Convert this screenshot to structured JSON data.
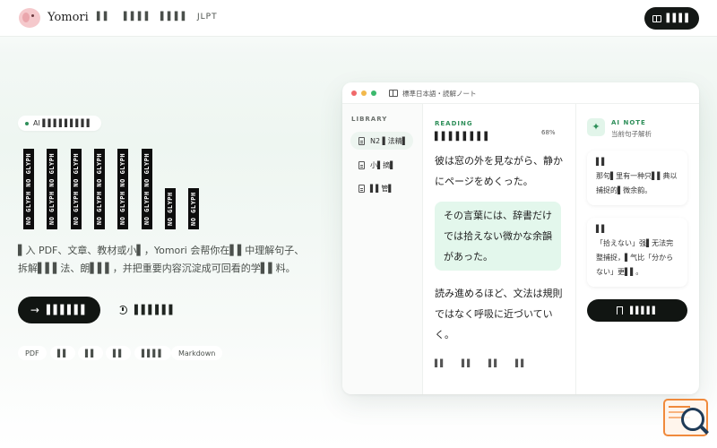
{
  "header": {
    "brand": "Yomori",
    "nav": [
      "▌▌",
      "▌▌▌▌",
      "▌▌▌▌",
      "JLPT"
    ],
    "cta_label": "▌▌▌▌"
  },
  "hero": {
    "tag": "AI ▌▌▌▌▌▌▌▌▌",
    "headline_bars": [
      "NO GLYPH NO GLYPH",
      "NO GLYPH NO GLYPH",
      "NO GLYPH NO GLYPH",
      "NO GLYPH NO GLYPH",
      "NO GLYPH NO GLYPH",
      "NO GLYPH NO GLYPH",
      "NO GLYPH",
      "NO GLYPH"
    ],
    "subtext_line1": "▌入 PDF、文章、教材或小▌，Yomori 会帮你在▌▌中理解句子、",
    "subtext_line2": "拆解▌▌▌法、朗▌▌▌，并把重要内容沉淀成可回看的学▌▌料。",
    "primary_cta": "▌▌▌▌▌▌",
    "secondary_cta": "▌▌▌▌▌▌",
    "chips": [
      "PDF",
      "▌▌",
      "▌▌",
      "▌▌",
      "▌▌▌▌",
      "Markdown"
    ]
  },
  "window": {
    "title": "標準日本語・読解ノート",
    "sidebar": {
      "title": "LIBRARY",
      "items": [
        {
          "label": "N2 ▌法精▌"
        },
        {
          "label": "小▌摘▌"
        },
        {
          "label": "▌▌管▌"
        }
      ]
    },
    "reader": {
      "label": "READING",
      "doc_title": "▌▌▌▌▌▌▌▌",
      "progress": "68%",
      "para1": "彼は窓の外を見ながら、静かにページをめくった。",
      "para2": "その言葉には、辞書だけでは拾えない微かな余韻があった。",
      "para3": "読み進めるほど、文法は規則ではなく呼吸に近づいていく。",
      "actions": [
        "▌▌",
        "▌▌",
        "▌▌",
        "▌▌"
      ]
    },
    "ai": {
      "label": "AI NOTE",
      "sub": "当前句子解析",
      "card1_title": "▌▌",
      "card1_body": "那句▌里有一种只▌▌典以捕捉的▌微余韵。",
      "card2_title": "▌▌",
      "card2_body": "「拾えない」强▌无法完整捕捉，▌气比「分からない」更▌▌。",
      "save_label": "▌▌▌▌▌"
    }
  },
  "colors": {
    "accent": "#2f8f5a",
    "dark": "#111512",
    "highlight": "#e3f7ec",
    "dot_red": "#f0696a",
    "dot_yellow": "#f2b84b",
    "dot_green": "#3bb96d"
  }
}
